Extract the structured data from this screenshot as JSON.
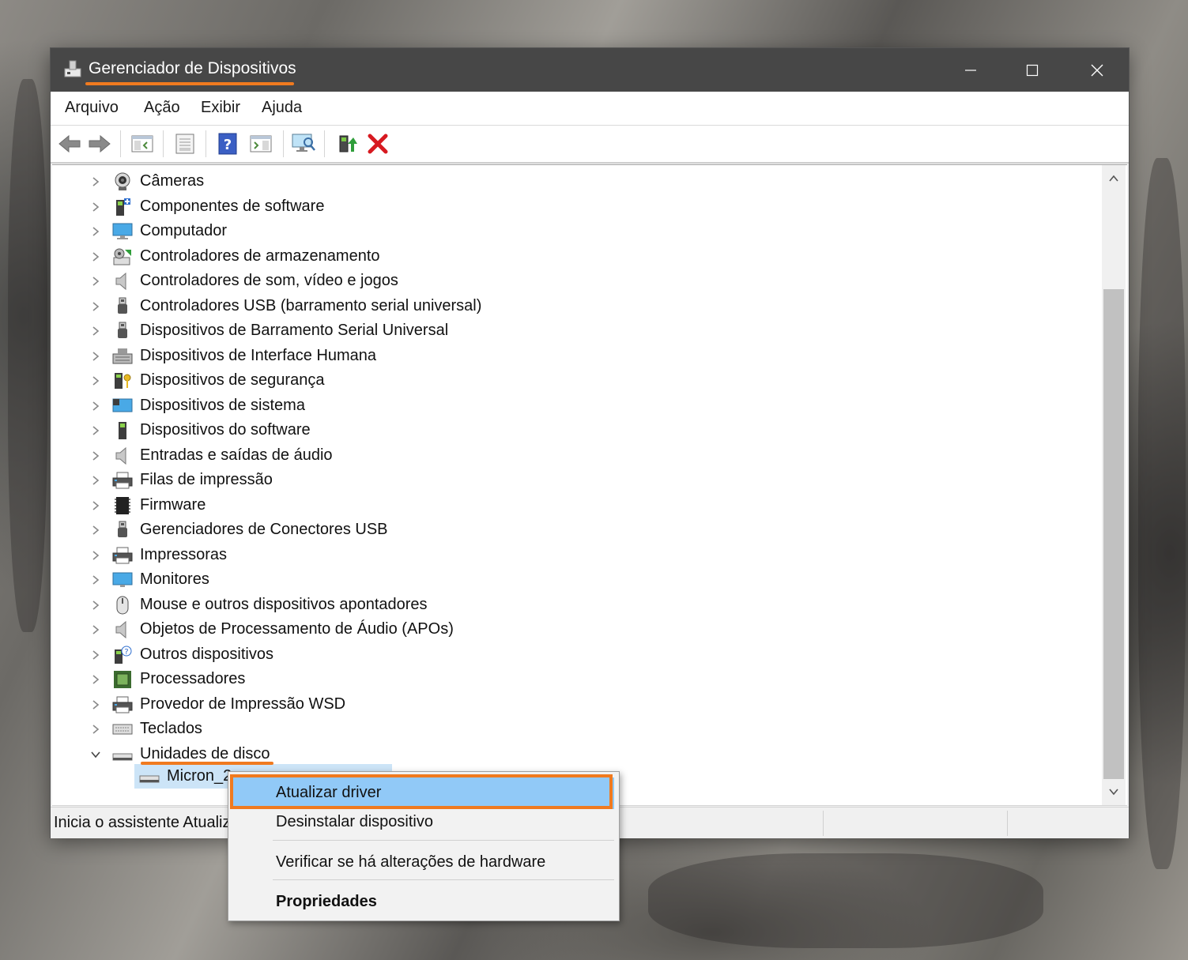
{
  "window": {
    "title": "Gerenciador de Dispositivos",
    "controls": [
      "minimize",
      "maximize",
      "close"
    ]
  },
  "menubar": {
    "items": [
      "Arquivo",
      "Ação",
      "Exibir",
      "Ajuda"
    ]
  },
  "toolbar": {
    "buttons": [
      "back-arrow-icon",
      "forward-arrow-icon",
      "show-hide-console-tree-icon",
      "properties-icon",
      "help-icon",
      "action-pane-icon",
      "scan-hardware-icon",
      "update-driver-icon",
      "uninstall-red-x-icon"
    ]
  },
  "tree": {
    "items": [
      {
        "label": "Câmeras",
        "icon": "camera-icon",
        "expanded": false
      },
      {
        "label": "Componentes de software",
        "icon": "software-component-icon",
        "expanded": false
      },
      {
        "label": "Computador",
        "icon": "computer-icon",
        "expanded": false
      },
      {
        "label": "Controladores de armazenamento",
        "icon": "storage-controller-icon",
        "expanded": false
      },
      {
        "label": "Controladores de som, vídeo e jogos",
        "icon": "speaker-icon",
        "expanded": false
      },
      {
        "label": "Controladores USB (barramento serial universal)",
        "icon": "usb-icon",
        "expanded": false
      },
      {
        "label": "Dispositivos de Barramento Serial Universal",
        "icon": "usb-icon",
        "expanded": false
      },
      {
        "label": "Dispositivos de Interface Humana",
        "icon": "hid-icon",
        "expanded": false
      },
      {
        "label": "Dispositivos de segurança",
        "icon": "security-key-icon",
        "expanded": false
      },
      {
        "label": "Dispositivos de sistema",
        "icon": "system-device-icon",
        "expanded": false
      },
      {
        "label": "Dispositivos do software",
        "icon": "software-device-icon",
        "expanded": false
      },
      {
        "label": "Entradas e saídas de áudio",
        "icon": "speaker-icon",
        "expanded": false
      },
      {
        "label": "Filas de impressão",
        "icon": "printer-icon",
        "expanded": false
      },
      {
        "label": "Firmware",
        "icon": "firmware-chip-icon",
        "expanded": false
      },
      {
        "label": "Gerenciadores de Conectores USB",
        "icon": "usb-icon",
        "expanded": false
      },
      {
        "label": "Impressoras",
        "icon": "printer-icon",
        "expanded": false
      },
      {
        "label": "Monitores",
        "icon": "monitor-icon",
        "expanded": false
      },
      {
        "label": "Mouse e outros dispositivos apontadores",
        "icon": "mouse-icon",
        "expanded": false
      },
      {
        "label": "Objetos de Processamento de Áudio (APOs)",
        "icon": "speaker-icon",
        "expanded": false
      },
      {
        "label": "Outros dispositivos",
        "icon": "unknown-device-icon",
        "expanded": false
      },
      {
        "label": "Processadores",
        "icon": "processor-icon",
        "expanded": false
      },
      {
        "label": "Provedor de Impressão WSD",
        "icon": "printer-icon",
        "expanded": false
      },
      {
        "label": "Teclados",
        "icon": "keyboard-icon",
        "expanded": false
      },
      {
        "label": "Unidades de disco",
        "icon": "disk-drive-icon",
        "expanded": true
      }
    ],
    "child": {
      "label": "Micron_2",
      "icon": "disk-drive-icon",
      "selected": true
    }
  },
  "status": {
    "text": "Inicia o assistente Atualiz"
  },
  "context_menu": {
    "items": [
      {
        "label": "Atualizar driver",
        "highlighted": true,
        "bold": false
      },
      {
        "label": "Desinstalar dispositivo",
        "highlighted": false,
        "bold": false
      },
      {
        "label": "Verificar se há alterações de hardware",
        "highlighted": false,
        "bold": false
      },
      {
        "label": "Propriedades",
        "highlighted": false,
        "bold": true
      }
    ]
  },
  "colors": {
    "titlebar": "#474747",
    "highlight_orange": "#f07a1f",
    "menu_highlight": "#91c9f7",
    "selection": "#cce4f7"
  }
}
